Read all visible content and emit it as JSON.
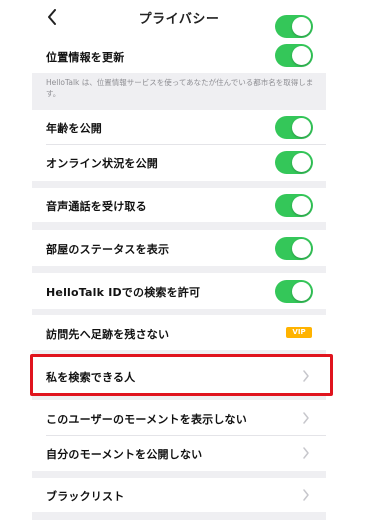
{
  "header": {
    "title": "プライバシー"
  },
  "rows": {
    "update_location": "位置情報を更新",
    "location_note": "HelloTalk は、位置情報サービスを使ってあなたが住んでいる都市名を取得します。",
    "show_age": "年齢を公開",
    "show_online": "オンライン状況を公開",
    "receive_voice": "音声通話を受け取る",
    "show_room_status": "部屋のステータスを表示",
    "allow_id_search": "HelloTalk IDでの検索を許可",
    "no_footprint": "訪問先へ足跡を残さない",
    "who_can_find_me": "私を検索できる人",
    "hide_user_moments": "このユーザーのモーメントを表示しない",
    "hide_my_moments": "自分のモーメントを公開しない",
    "blacklist": "ブラックリスト"
  },
  "badges": {
    "vip": "VIP"
  },
  "colors": {
    "toggle_on": "#34c759",
    "highlight": "#e0141e",
    "background": "#efeff2"
  },
  "toggles": {
    "update_location": true,
    "show_age": true,
    "show_online": true,
    "receive_voice": true,
    "show_room_status": true,
    "allow_id_search": true
  }
}
